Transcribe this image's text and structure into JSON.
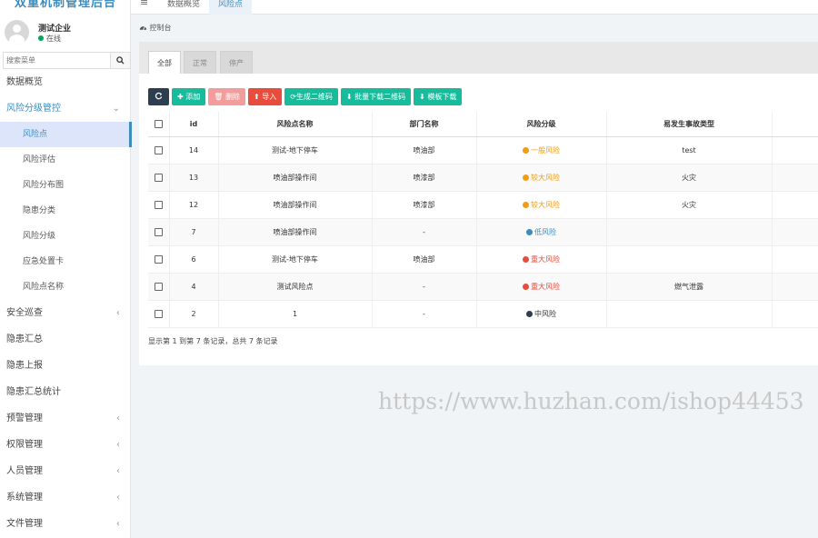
{
  "app": {
    "logo_text": "双重机制管理后台"
  },
  "user": {
    "name": "测试企业",
    "status": "在线"
  },
  "search": {
    "placeholder": "搜索菜单"
  },
  "sidebar": {
    "items": [
      {
        "label": "数据概览"
      },
      {
        "label": "风险分级管控",
        "expanded": true,
        "arrow": "⌄"
      },
      {
        "label": "安全巡查",
        "arrow": "‹"
      },
      {
        "label": "隐患汇总"
      },
      {
        "label": "隐患上报"
      },
      {
        "label": "隐患汇总统计"
      },
      {
        "label": "预警管理",
        "arrow": "‹"
      },
      {
        "label": "权限管理",
        "arrow": "‹"
      },
      {
        "label": "人员管理",
        "arrow": "‹"
      },
      {
        "label": "系统管理",
        "arrow": "‹"
      },
      {
        "label": "文件管理",
        "arrow": "‹"
      }
    ],
    "sub_items": [
      {
        "label": "风险点",
        "active": true
      },
      {
        "label": "风险评估"
      },
      {
        "label": "风险分布图"
      },
      {
        "label": "隐患分类"
      },
      {
        "label": "风险分级"
      },
      {
        "label": "应急处置卡"
      },
      {
        "label": "风险点名称"
      }
    ]
  },
  "topbar": {
    "tabs": [
      {
        "label": "数据概览"
      },
      {
        "label": "风险点",
        "active": true
      }
    ]
  },
  "breadcrumb": {
    "label": "控制台"
  },
  "panel_tabs": [
    {
      "label": "全部",
      "active": true
    },
    {
      "label": "正常"
    },
    {
      "label": "停产"
    }
  ],
  "toolbar": {
    "add": "添加",
    "delete": "删除",
    "import": "导入",
    "gen_qr": "生成二维码",
    "batch_download_qr": "批量下载二维码",
    "template_download": "模板下载"
  },
  "table": {
    "columns": [
      "id",
      "风险点名称",
      "部门名称",
      "风险分级",
      "易发生事故类型"
    ],
    "rows": [
      {
        "id": "14",
        "name": "测试-地下停车",
        "dept": "喷油部",
        "level": "一般风险",
        "level_color": "#f39c12",
        "accident": "test"
      },
      {
        "id": "13",
        "name": "喷油部操作间",
        "dept": "喷漆部",
        "level": "较大风险",
        "level_color": "#f39c12",
        "accident": "火灾"
      },
      {
        "id": "12",
        "name": "喷油部操作间",
        "dept": "喷漆部",
        "level": "较大风险",
        "level_color": "#f39c12",
        "accident": "火灾"
      },
      {
        "id": "7",
        "name": "喷油部操作间",
        "dept": "-",
        "level": "低风险",
        "level_color": "#3c8dbc",
        "accident": ""
      },
      {
        "id": "6",
        "name": "测试-地下停车",
        "dept": "喷油部",
        "level": "重大风险",
        "level_color": "#e74c3c",
        "accident": ""
      },
      {
        "id": "4",
        "name": "测试风险点",
        "dept": "-",
        "level": "重大风险",
        "level_color": "#e74c3c",
        "accident": "燃气泄露"
      },
      {
        "id": "2",
        "name": "1",
        "dept": "-",
        "level": "中风险",
        "level_color": "#2c3e50",
        "accident": ""
      }
    ]
  },
  "footer": {
    "summary": "显示第 1 到第 7 条记录，总共 7 条记录"
  },
  "watermark": {
    "text": "https://www.huzhan.com/ishop44453"
  },
  "colors": {
    "accent": "#3c8dbc",
    "success": "#18bc9c",
    "danger": "#e74c3c",
    "dark": "#2c3e50"
  }
}
